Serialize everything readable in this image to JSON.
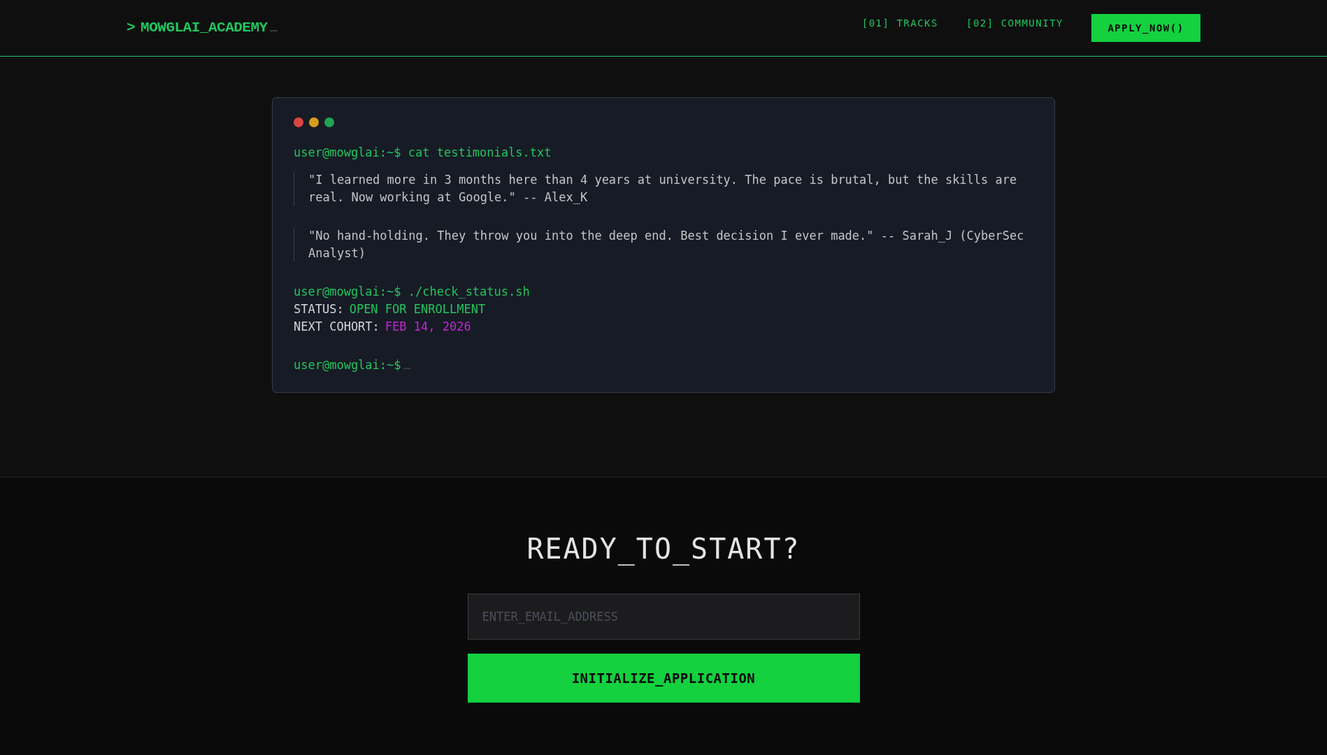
{
  "header": {
    "logo_mark": ">",
    "logo": "MOWGLAI_ACADEMY",
    "nav": [
      {
        "label": "[01] TRACKS"
      },
      {
        "label": "[02] COMMUNITY"
      }
    ],
    "cta": "APPLY_NOW()"
  },
  "terminal": {
    "lines": [
      {
        "kind": "command",
        "prompt": "user@mowglai:~$",
        "command": "cat testimonials.txt"
      },
      {
        "kind": "quote",
        "text": "\"I learned more in 3 months here than 4 years at university. The pace is brutal, but the skills are real. Now working at Google.\" -- Alex_K"
      },
      {
        "kind": "quote",
        "text": "\"No hand-holding. They throw you into the deep end. Best decision I ever made.\" -- Sarah_J (CyberSec Analyst)"
      },
      {
        "kind": "command",
        "prompt": "user@mowglai:~$",
        "command": "./check_status.sh"
      },
      {
        "kind": "output",
        "label": "STATUS:",
        "value": "OPEN FOR ENROLLMENT",
        "color": "#22c55e"
      },
      {
        "kind": "output",
        "label": "NEXT COHORT:",
        "value": "FEB 14, 2026",
        "color": "#c026d3"
      },
      {
        "kind": "prompt",
        "prompt": "user@mowglai:~$"
      }
    ]
  },
  "signup": {
    "title": "READY_TO_START?",
    "email": {
      "placeholder": "ENTER_EMAIL_ADDRESS"
    },
    "submit": "INITIALIZE_APPLICATION"
  }
}
